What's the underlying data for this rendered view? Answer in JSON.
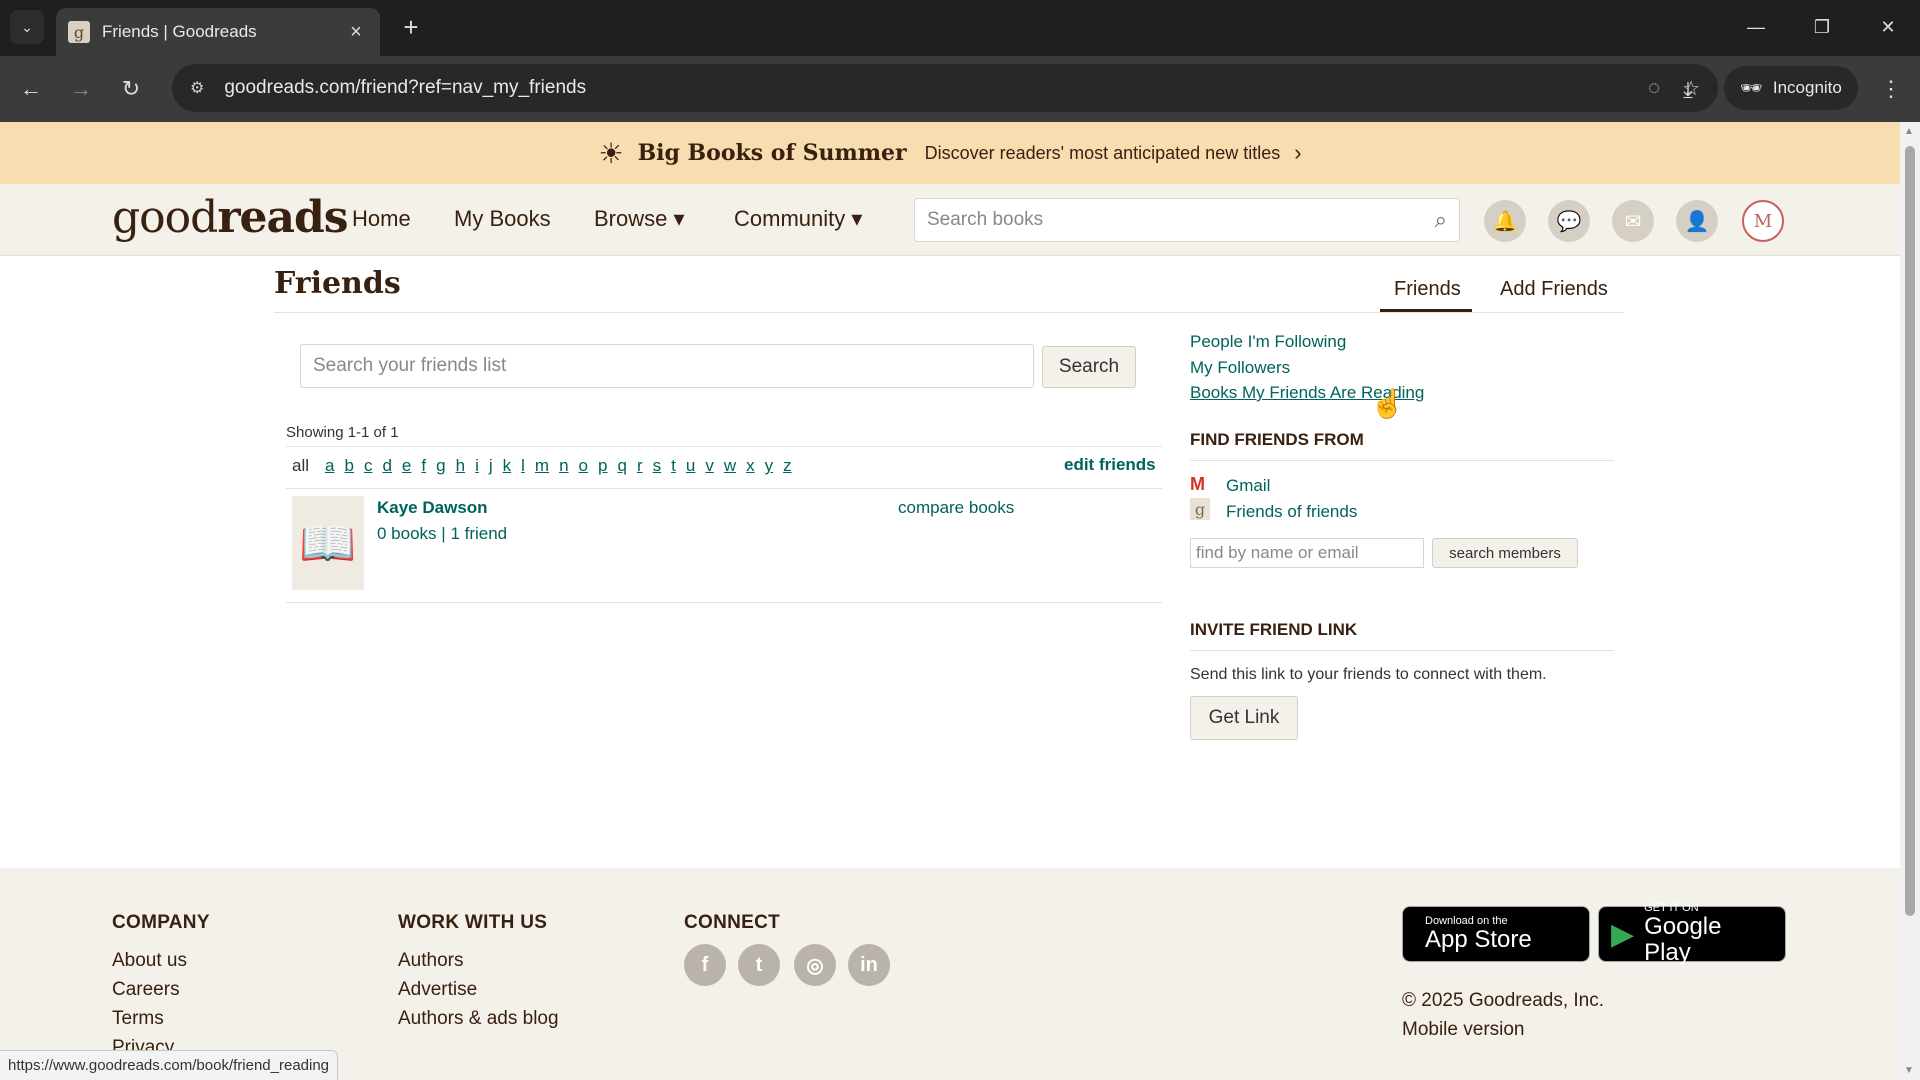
{
  "browser": {
    "tab_title": "Friends | Goodreads",
    "tab_favicon_letter": "g",
    "url": "goodreads.com/friend?ref=nav_my_friends",
    "incognito_label": "Incognito",
    "status_url": "https://www.goodreads.com/book/friend_reading"
  },
  "promo": {
    "title": "Big Books of Summer",
    "subtitle": "Discover readers' most anticipated new titles"
  },
  "header": {
    "logo_light": "good",
    "logo_bold": "reads",
    "nav": {
      "home": "Home",
      "my_books": "My Books",
      "browse": "Browse ▾",
      "community": "Community ▾"
    },
    "search_placeholder": "Search books",
    "avatar_letter": "M"
  },
  "main": {
    "title": "Friends",
    "tabs": {
      "friends": "Friends",
      "add_friends": "Add Friends"
    },
    "search_placeholder": "Search your friends list",
    "search_button": "Search",
    "showing": "Showing 1-1 of 1",
    "alpha_all": "all",
    "letters": [
      "a",
      "b",
      "c",
      "d",
      "e",
      "f",
      "g",
      "h",
      "i",
      "j",
      "k",
      "l",
      "m",
      "n",
      "o",
      "p",
      "q",
      "r",
      "s",
      "t",
      "u",
      "v",
      "w",
      "x",
      "y",
      "z"
    ],
    "edit_friends": "edit friends",
    "friends": [
      {
        "name": "Kaye Dawson",
        "books": "0 books",
        "separator": "|",
        "friends": "1 friend",
        "compare": "compare books"
      }
    ]
  },
  "sidebar": {
    "links": {
      "following": "People I'm Following",
      "followers": "My Followers",
      "reading": "Books My Friends Are Reading"
    },
    "find_heading": "FIND FRIENDS FROM",
    "gmail": "Gmail",
    "friends_of_friends": "Friends of friends",
    "find_placeholder": "find by name or email",
    "search_members": "search members",
    "invite_heading": "INVITE FRIEND LINK",
    "invite_text": "Send this link to your friends to connect with them.",
    "get_link": "Get Link"
  },
  "footer": {
    "company": {
      "heading": "COMPANY",
      "links": [
        "About us",
        "Careers",
        "Terms",
        "Privacy"
      ]
    },
    "work": {
      "heading": "WORK WITH US",
      "links": [
        "Authors",
        "Advertise",
        "Authors & ads blog"
      ]
    },
    "connect": {
      "heading": "CONNECT",
      "icons": [
        "facebook-icon",
        "twitter-icon",
        "instagram-icon",
        "linkedin-icon"
      ]
    },
    "app_store": {
      "small": "Download on the",
      "big": "App Store"
    },
    "google_play": {
      "small": "GET IT ON",
      "big": "Google Play"
    },
    "copyright": "© 2025 Goodreads, Inc.",
    "mobile_version": "Mobile version"
  },
  "colors": {
    "brand_brown": "#382110",
    "link_green": "#00635d",
    "header_bg": "#f4f1ea",
    "promo_bg": "#f8ddb1"
  }
}
